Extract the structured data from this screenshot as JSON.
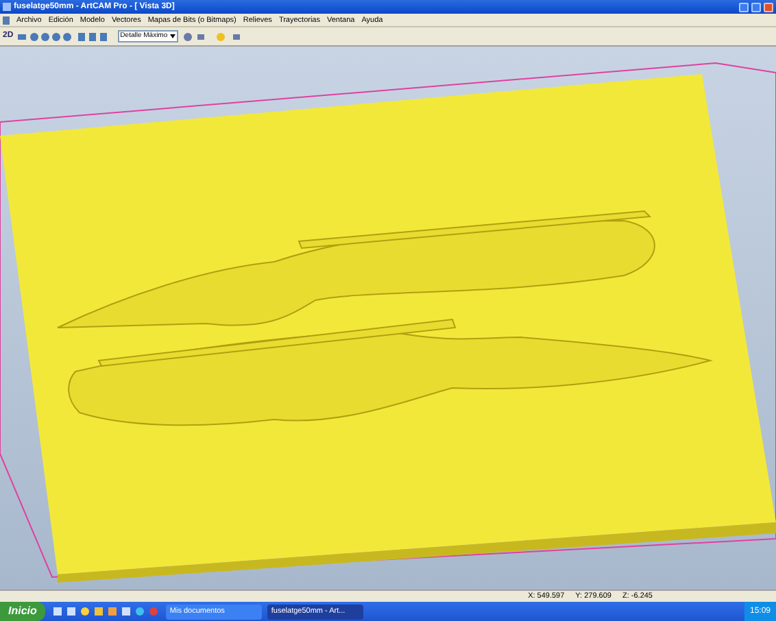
{
  "window": {
    "title": "fuselatge50mm - ArtCAM Pro - [ Vista 3D]"
  },
  "menu": [
    "Archivo",
    "Edición",
    "Modelo",
    "Vectores",
    "Mapas de Bits (o Bitmaps)",
    "Relieves",
    "Trayectorias",
    "Ventana",
    "Ayuda"
  ],
  "toolbar": {
    "mode_label": "2D",
    "detail_dropdown": "Detalle Máximo"
  },
  "status_bar": [
    "X: 549.597",
    "Y: 279.609",
    "Z: -6.245"
  ],
  "taskbar": {
    "start": "Inicio",
    "tasks": [
      {
        "label": "Mis documentos",
        "selected": false
      },
      {
        "label": "fuselatge50mm - Art...",
        "selected": true
      }
    ],
    "clock": "15:09"
  }
}
